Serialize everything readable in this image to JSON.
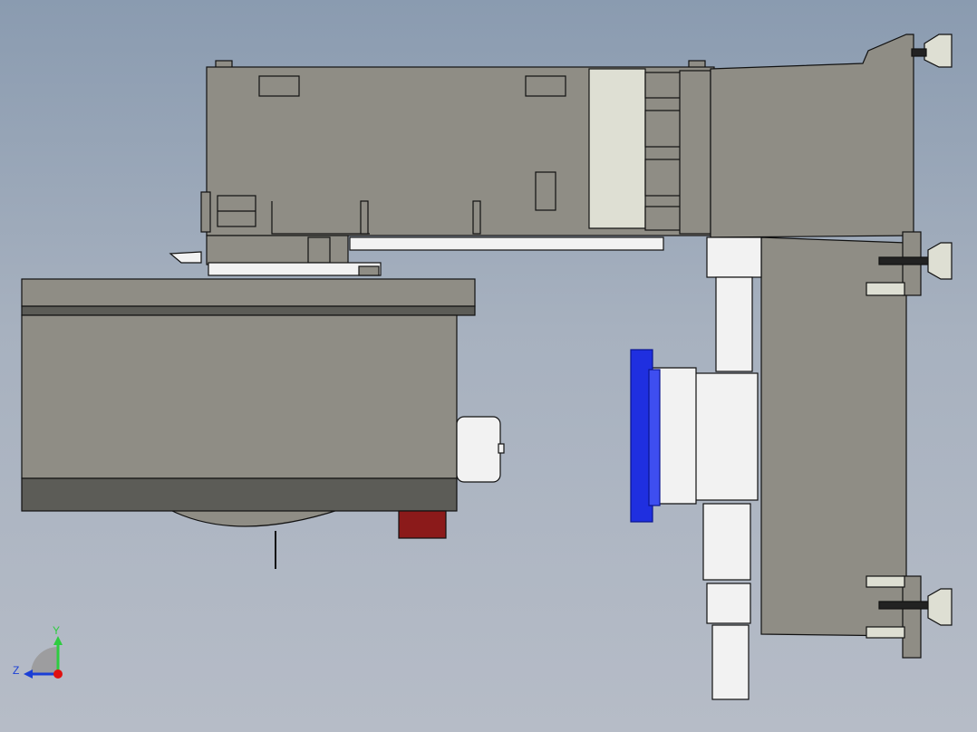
{
  "viewport": {
    "description_label": "",
    "colors": {
      "background_top": "#8a9bb0",
      "background_bottom": "#b6bcc7",
      "body_gray": "#8f8d85",
      "body_dark": "#5c5c57",
      "light_panel": "#dedfd3",
      "blue_gripper": "#1f2fe0",
      "red_block": "#8b1a1a",
      "white_part": "#f2f2f2"
    }
  },
  "triad": {
    "y_label": "Y",
    "z_label": "Z",
    "y_color": "#2ecc40",
    "z_color": "#1b3fd6",
    "origin_color": "#e01010"
  }
}
